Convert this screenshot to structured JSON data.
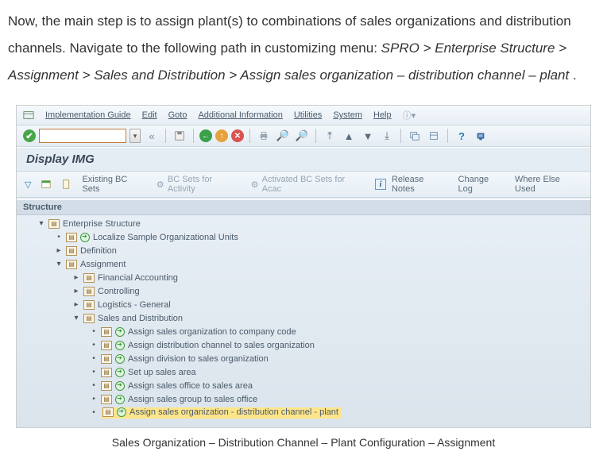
{
  "article": {
    "para1_a": "Now, the main step is to assign plant(s) to combinations of sales organizations and distribution channels. Navigate to the following path in customizing menu: ",
    "path": "SPRO > Enterprise Structure > Assignment > Sales and Distribution > Assign sales organization – distribution channel – plant",
    "para1_b": "."
  },
  "menu": {
    "m1": "Implementation Guide",
    "m2": "Edit",
    "m3": "Goto",
    "m4": "Additional Information",
    "m5": "Utilities",
    "m6": "System",
    "m7": "Help"
  },
  "cmd": {
    "placeholder": ""
  },
  "title": "Display IMG",
  "actions": {
    "existing": "Existing BC Sets",
    "bcsets": "BC Sets for Activity",
    "activated": "Activated BC Sets for Acac",
    "release": "Release Notes",
    "changelog": "Change Log",
    "whereelse": "Where Else Used"
  },
  "tree": {
    "header": "Structure",
    "n1": "Enterprise Structure",
    "n2": "Localize Sample Organizational Units",
    "n3": "Definition",
    "n4": "Assignment",
    "n5": "Financial Accounting",
    "n6": "Controlling",
    "n7": "Logistics - General",
    "n8": "Sales and Distribution",
    "l1": "Assign sales organization to company code",
    "l2": "Assign distribution channel to sales organization",
    "l3": "Assign division to sales organization",
    "l4": "Set up sales area",
    "l5": "Assign sales office to sales area",
    "l6": "Assign sales group to sales office",
    "l7": "Assign sales organization - distribution channel - plant"
  },
  "caption": "Sales Organization – Distribution Channel – Plant Configuration – Assignment"
}
